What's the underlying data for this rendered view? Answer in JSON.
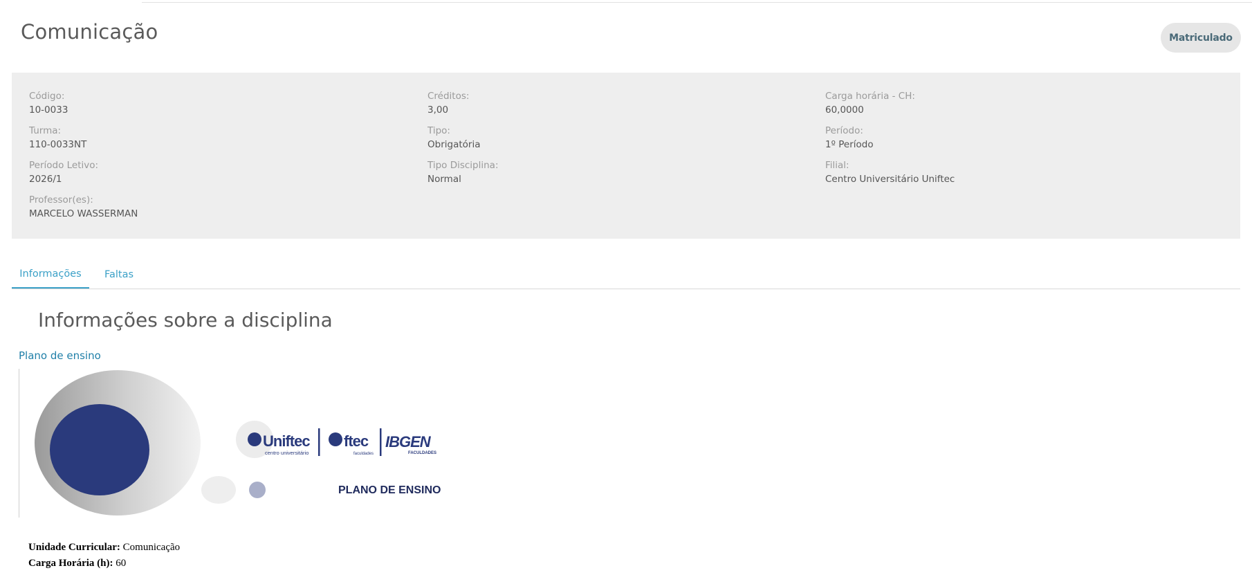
{
  "header": {
    "title": "Comunicação",
    "status": "Matriculado"
  },
  "info": {
    "col1": [
      {
        "label": "Código:",
        "value": "10-0033"
      },
      {
        "label": "Turma:",
        "value": "110-0033NT"
      },
      {
        "label": "Período Letivo:",
        "value": "2026/1"
      },
      {
        "label": "Professor(es):",
        "value": "MARCELO WASSERMAN"
      }
    ],
    "col2": [
      {
        "label": "Créditos:",
        "value": "3,00"
      },
      {
        "label": "Tipo:",
        "value": "Obrigatória"
      },
      {
        "label": "Tipo Disciplina:",
        "value": "Normal"
      }
    ],
    "col3": [
      {
        "label": "Carga horária - CH:",
        "value": "60,0000"
      },
      {
        "label": "Período:",
        "value": "1º Período"
      },
      {
        "label": "Filial:",
        "value": "Centro Universitário Uniftec"
      }
    ]
  },
  "tabs": [
    {
      "label": "Informações",
      "active": true
    },
    {
      "label": "Faltas",
      "active": false
    }
  ],
  "section": {
    "title": "Informações sobre a disciplina",
    "plan_link": "Plano de ensino"
  },
  "plan_image": {
    "brand1": "Uniftec",
    "brand1_sub": "centro universitário",
    "brand2": "ftec",
    "brand2_sub": "faculdades",
    "brand3": "IBGEN",
    "brand3_sub": "FACULDADES",
    "heading": "PLANO DE ENSINO"
  },
  "plan_fields": [
    {
      "label": "Unidade Curricular:",
      "value": " Comunicação"
    },
    {
      "label": "Carga Horária (h):",
      "value": " 60"
    }
  ],
  "colors": {
    "accent": "#3aa0c7",
    "brand_navy": "#2a3a7c",
    "panel_bg": "#eeeeee"
  }
}
